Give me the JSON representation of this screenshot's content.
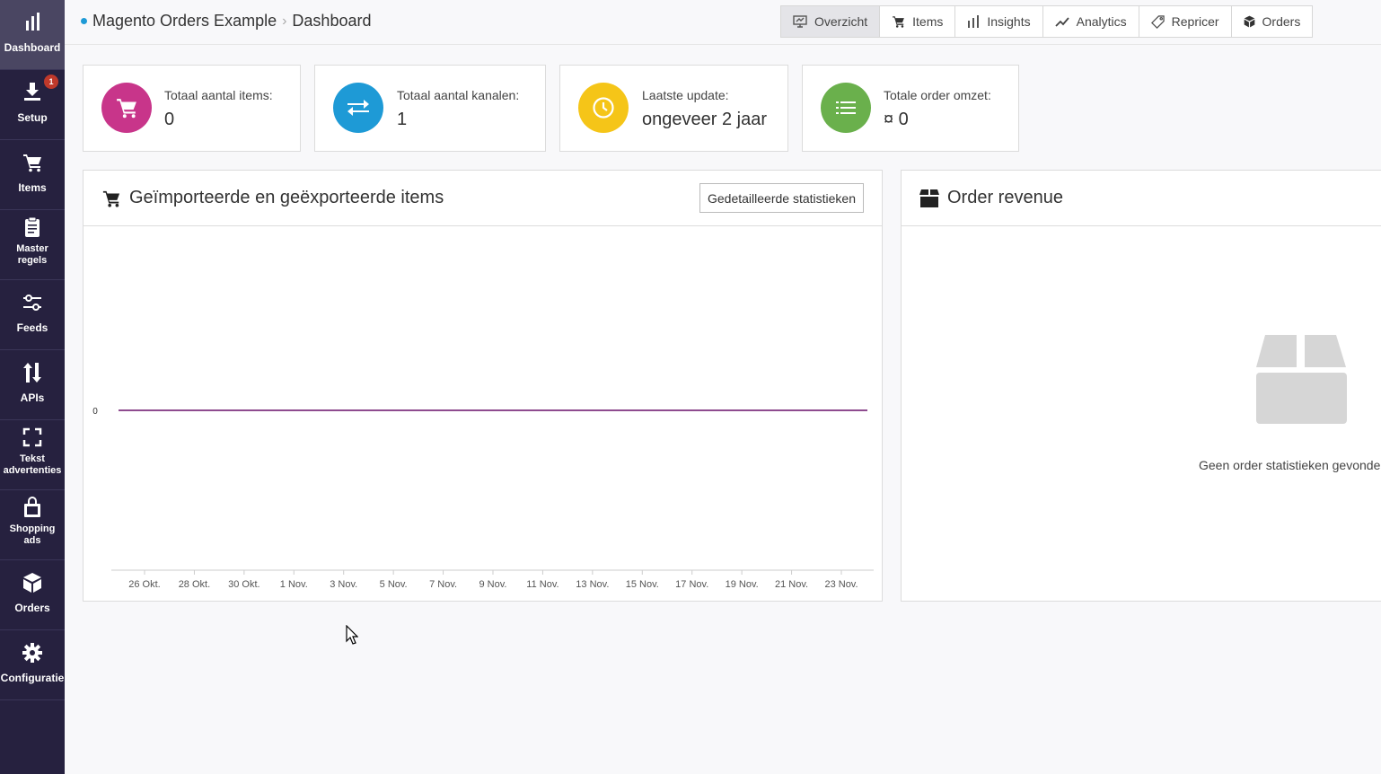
{
  "sidebar": {
    "items": [
      {
        "label": "Dashboard",
        "icon": "bar-chart-icon"
      },
      {
        "label": "Setup",
        "icon": "download-icon",
        "badge": "1"
      },
      {
        "label": "Items",
        "icon": "cart-icon"
      },
      {
        "label_line1": "Master",
        "label_line2": "regels",
        "icon": "clipboard-icon"
      },
      {
        "label": "Feeds",
        "icon": "sliders-icon"
      },
      {
        "label": "APIs",
        "icon": "arrows-updown-icon"
      },
      {
        "label_line1": "Tekst",
        "label_line2": "advertenties",
        "icon": "expand-icon"
      },
      {
        "label_line1": "Shopping",
        "label_line2": "ads",
        "icon": "shopping-bag-icon"
      },
      {
        "label": "Orders",
        "icon": "cube-icon"
      },
      {
        "label": "Configuratie",
        "icon": "gear-icon"
      }
    ]
  },
  "header": {
    "breadcrumb": {
      "parent": "Magento Orders Example",
      "current": "Dashboard"
    },
    "tabs": [
      {
        "label": "Overzicht",
        "icon": "presentation-icon",
        "active": true
      },
      {
        "label": "Items",
        "icon": "cart-icon"
      },
      {
        "label": "Insights",
        "icon": "bar-chart-icon"
      },
      {
        "label": "Analytics",
        "icon": "line-chart-icon"
      },
      {
        "label": "Repricer",
        "icon": "tag-icon"
      },
      {
        "label": "Orders",
        "icon": "cube-icon"
      }
    ]
  },
  "stats": [
    {
      "title": "Totaal aantal items:",
      "value": "0",
      "icon": "cart-icon",
      "color": "#c8358a"
    },
    {
      "title": "Totaal aantal kanalen:",
      "value": "1",
      "icon": "exchange-icon",
      "color": "#1e9ad6"
    },
    {
      "title": "Laatste update:",
      "value": "ongeveer 2 jaar",
      "icon": "clock-icon",
      "color": "#f5c518"
    },
    {
      "title": "Totale order omzet:",
      "value": "¤ 0",
      "icon": "list-icon",
      "color": "#6ab04c"
    }
  ],
  "items_panel": {
    "title": "Geïmporteerde en geëxporteerde items",
    "button": "Gedetailleerde statistieken"
  },
  "revenue_panel": {
    "title": "Order revenue",
    "empty_text": "Geen order statistieken gevonden"
  },
  "chart_data": {
    "type": "line",
    "x": [
      "26 Okt.",
      "28 Okt.",
      "30 Okt.",
      "1 Nov.",
      "3 Nov.",
      "5 Nov.",
      "7 Nov.",
      "9 Nov.",
      "11 Nov.",
      "13 Nov.",
      "15 Nov.",
      "17 Nov.",
      "19 Nov.",
      "21 Nov.",
      "23 Nov."
    ],
    "series": [
      {
        "values": [
          0,
          0,
          0,
          0,
          0,
          0,
          0,
          0,
          0,
          0,
          0,
          0,
          0,
          0,
          0
        ],
        "color": "#8e4b8f"
      }
    ],
    "yticks": [
      "0"
    ],
    "grid": false
  }
}
